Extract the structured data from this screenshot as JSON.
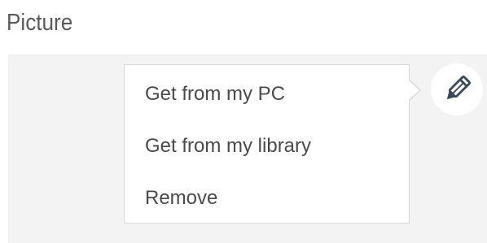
{
  "section": {
    "title": "Picture"
  },
  "menu": {
    "items": [
      {
        "label": "Get from my PC"
      },
      {
        "label": "Get from my library"
      },
      {
        "label": "Remove"
      }
    ]
  },
  "edit_button": {
    "icon": "pencil-icon"
  },
  "colors": {
    "title_text": "#5a5a5a",
    "menu_text": "#4a4a4a",
    "picture_area_bg": "#f3f3f3",
    "menu_border": "#d9d9d9",
    "icon": "#3a4a5a"
  }
}
